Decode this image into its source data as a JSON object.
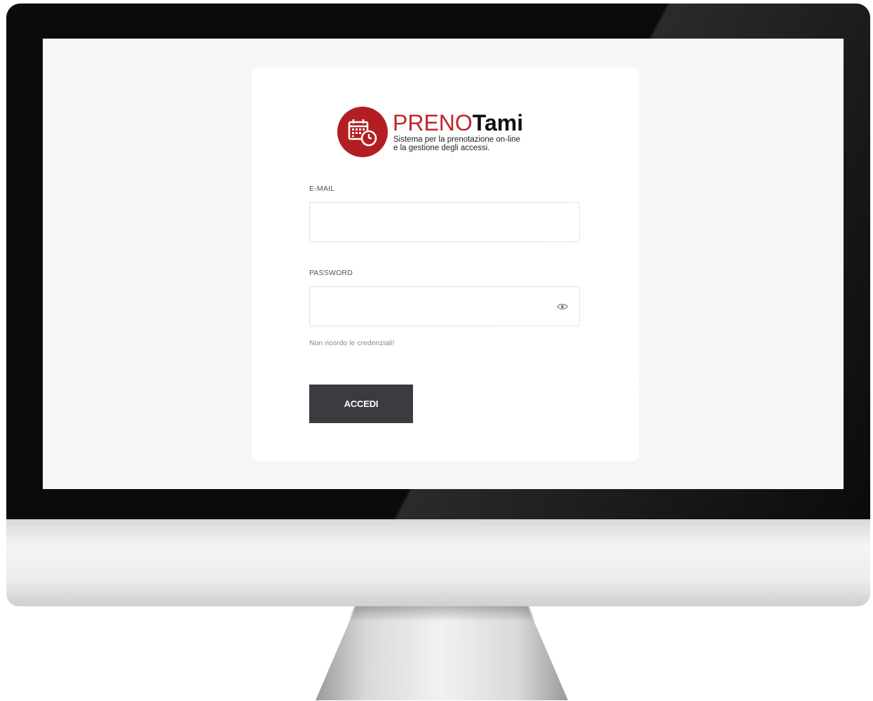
{
  "brand": {
    "name_part1": "PRENO",
    "name_part2": "Tami",
    "tagline_line1": "Sistema per la prenotazione on-line",
    "tagline_line2": "e la gestione degli accessi.",
    "accent_color": "#c0262b"
  },
  "login_form": {
    "email_label": "E-MAIL",
    "email_value": "",
    "password_label": "PASSWORD",
    "password_value": "",
    "password_toggle_icon": "eye-icon",
    "forgot_link": "Non ricordo le credenziali!",
    "submit_label": "ACCEDI",
    "button_color": "#3d3a40"
  }
}
